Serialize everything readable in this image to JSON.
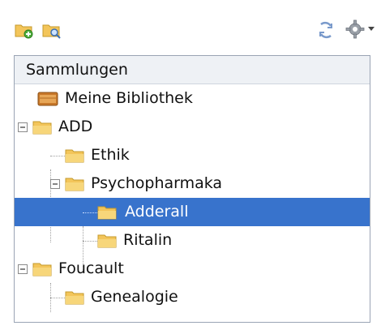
{
  "toolbar": {
    "new_collection_icon": "folder-add-icon",
    "new_saved_search_icon": "saved-search-icon",
    "sync_icon": "sync-icon",
    "actions_icon": "gear-icon"
  },
  "tree": {
    "header": "Sammlungen",
    "items": [
      {
        "label": "Meine Bibliothek",
        "icon": "library-icon",
        "level": 0
      },
      {
        "label": "ADD",
        "icon": "folder-icon",
        "level": 0,
        "expanded": true
      },
      {
        "label": "Ethik",
        "icon": "folder-icon",
        "level": 1
      },
      {
        "label": "Psychopharmaka",
        "icon": "folder-icon",
        "level": 1,
        "expanded": true
      },
      {
        "label": "Adderall",
        "icon": "folder-icon",
        "level": 2,
        "selected": true
      },
      {
        "label": "Ritalin",
        "icon": "folder-icon",
        "level": 2
      },
      {
        "label": "Foucault",
        "icon": "folder-icon",
        "level": 0,
        "expanded": true
      },
      {
        "label": "Genealogie",
        "icon": "folder-icon",
        "level": 1
      }
    ]
  },
  "colors": {
    "selection": "#3873cc",
    "folder": "#f3c55a",
    "library": "#c8782a"
  }
}
